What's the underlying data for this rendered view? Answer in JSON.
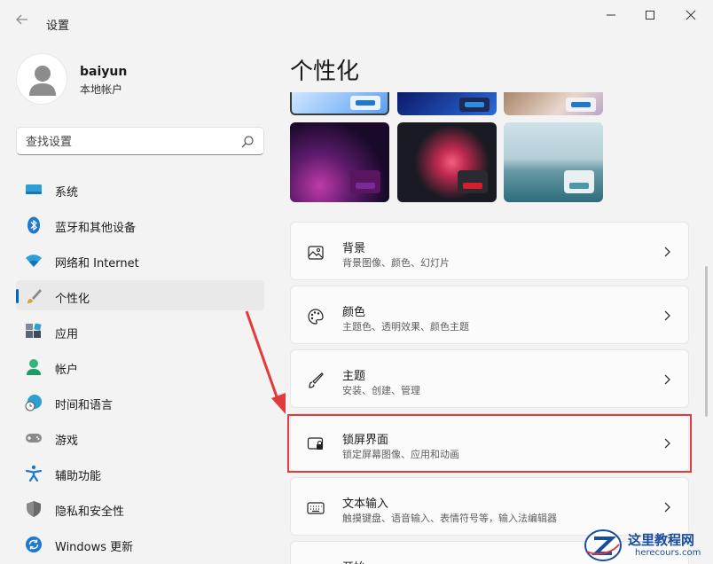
{
  "window": {
    "title": "设置",
    "back_icon": "back-arrow-icon",
    "controls": [
      "minimize-icon",
      "maximize-icon",
      "close-icon"
    ]
  },
  "profile": {
    "name": "baiyun",
    "account_type": "本地帐户"
  },
  "search": {
    "placeholder": "查找设置"
  },
  "sidebar": {
    "items": [
      {
        "label": "系统",
        "icon": "system-monitor-icon",
        "active": false
      },
      {
        "label": "蓝牙和其他设备",
        "icon": "bluetooth-icon",
        "active": false
      },
      {
        "label": "网络和 Internet",
        "icon": "wifi-icon",
        "active": false
      },
      {
        "label": "个性化",
        "icon": "paintbrush-icon",
        "active": true
      },
      {
        "label": "应用",
        "icon": "apps-icon",
        "active": false
      },
      {
        "label": "帐户",
        "icon": "account-icon",
        "active": false
      },
      {
        "label": "时间和语言",
        "icon": "globe-clock-icon",
        "active": false
      },
      {
        "label": "游戏",
        "icon": "gamepad-icon",
        "active": false
      },
      {
        "label": "辅助功能",
        "icon": "accessibility-icon",
        "active": false
      },
      {
        "label": "隐私和安全性",
        "icon": "shield-icon",
        "active": false
      },
      {
        "label": "Windows 更新",
        "icon": "update-icon",
        "active": false
      }
    ]
  },
  "main": {
    "title": "个性化",
    "settings": [
      {
        "title": "背景",
        "subtitle": "背景图像、颜色、幻灯片",
        "icon": "picture-icon"
      },
      {
        "title": "颜色",
        "subtitle": "主题色、透明效果、颜色主题",
        "icon": "palette-icon"
      },
      {
        "title": "主题",
        "subtitle": "安装、创建、管理",
        "icon": "brush-icon"
      },
      {
        "title": "锁屏界面",
        "subtitle": "锁定屏幕图像、应用和动画",
        "icon": "lock-screen-icon",
        "highlighted": true
      },
      {
        "title": "文本输入",
        "subtitle": "触摸键盘、语音输入、表情符号等，输入法编辑器",
        "icon": "keyboard-icon"
      },
      {
        "title": "开始",
        "subtitle": "",
        "icon": "start-icon"
      }
    ]
  },
  "watermark": {
    "name": "这里教程网",
    "url": "herecours.com"
  },
  "colors": {
    "accent": "#0067c0",
    "highlight_box": "#e23a3a",
    "arrow": "#e23a3a"
  }
}
